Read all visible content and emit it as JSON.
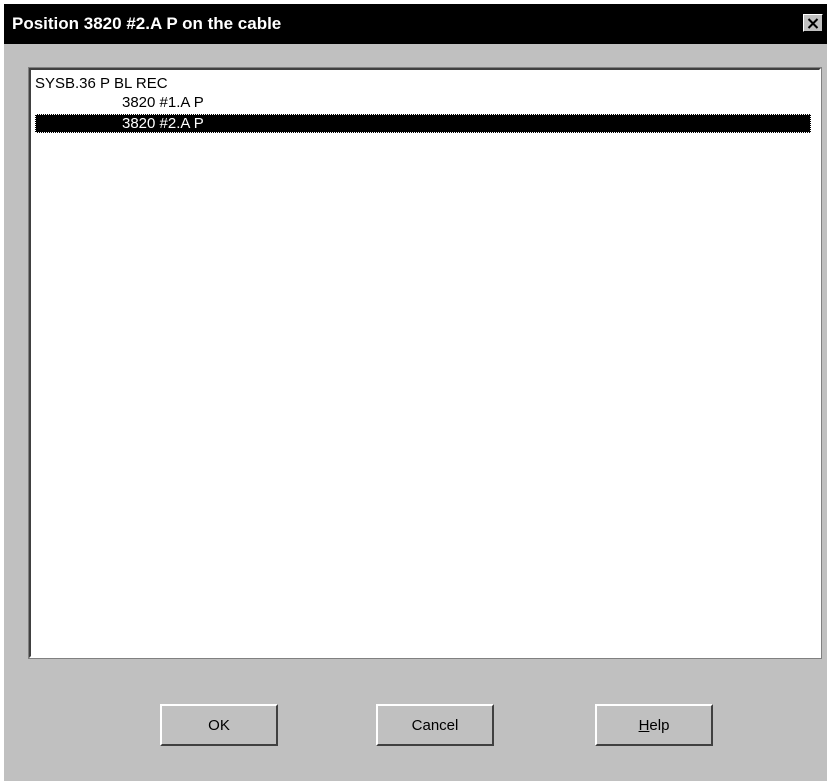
{
  "window": {
    "title": "Position 3820 #2.A P on the cable",
    "close_glyph": "✕"
  },
  "tree": {
    "items": [
      {
        "label": "SYSB.36 P BL REC",
        "level": 0,
        "selected": false
      },
      {
        "label": "3820 #1.A P",
        "level": 1,
        "selected": false
      },
      {
        "label": "3820 #2.A P",
        "level": 1,
        "selected": true
      }
    ]
  },
  "buttons": {
    "ok_label": "OK",
    "cancel_label": "Cancel",
    "help_accel": "H",
    "help_rest": "elp"
  },
  "colors": {
    "titlebar": "#000000",
    "dialog_bg": "#c0c0c0",
    "selection_bg": "#000000",
    "selection_fg": "#ffffff"
  },
  "icons": {
    "close": "close-icon"
  }
}
